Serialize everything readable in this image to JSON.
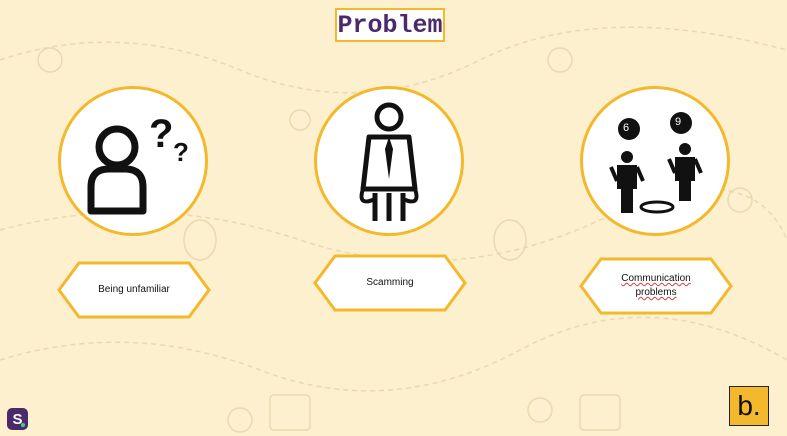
{
  "slide": {
    "title": "Problem",
    "items": [
      {
        "label": "Being unfamiliar",
        "icon": "confused-person-icon"
      },
      {
        "label": "Scamming",
        "icon": "empty-pockets-person-icon"
      },
      {
        "label": "Communication problems",
        "icon": "six-nine-perspective-icon",
        "bubbles": [
          "6",
          "9"
        ]
      }
    ]
  },
  "logos": {
    "left": "S.",
    "right": "b."
  },
  "colors": {
    "accent": "#f3b82c",
    "title": "#4b2a6b",
    "background": "#fdf0cf"
  }
}
